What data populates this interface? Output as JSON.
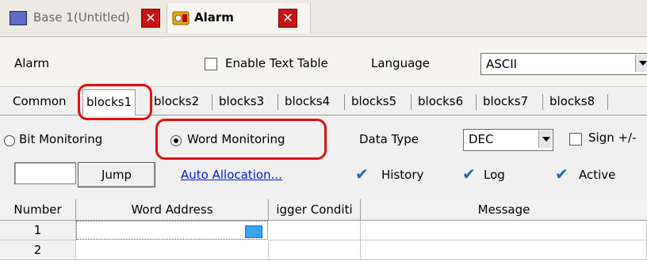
{
  "tabs": [
    {
      "label": "Base 1(Untitled)",
      "icon": "screen-icon"
    },
    {
      "label": "Alarm",
      "icon": "alarm-bell-icon"
    }
  ],
  "alarm_bar": {
    "title": "Alarm",
    "enable_text_table": "Enable Text Table",
    "language_label": "Language",
    "language_value": "ASCII"
  },
  "block_tabs": [
    "Common",
    "blocks1",
    "blocks2",
    "blocks3",
    "blocks4",
    "blocks5",
    "blocks6",
    "blocks7",
    "blocks8"
  ],
  "monitoring": {
    "bit": "Bit Monitoring",
    "word": "Word Monitoring",
    "selected": "word"
  },
  "data_type": {
    "label": "Data Type",
    "value": "DEC",
    "sign": "Sign +/-"
  },
  "jump": {
    "button": "Jump",
    "input_value": ""
  },
  "auto_allocation": "Auto Allocation...",
  "options": {
    "history": "History",
    "log": "Log",
    "active": "Active"
  },
  "grid": {
    "headers": [
      "Number",
      "Word Address",
      "igger Conditi",
      "Message"
    ],
    "rows": [
      {
        "number": "1"
      },
      {
        "number": "2"
      }
    ]
  },
  "colors": {
    "highlight": "#e01010",
    "link": "#0018d6",
    "check": "#1f63c8",
    "close": "#c81414"
  }
}
